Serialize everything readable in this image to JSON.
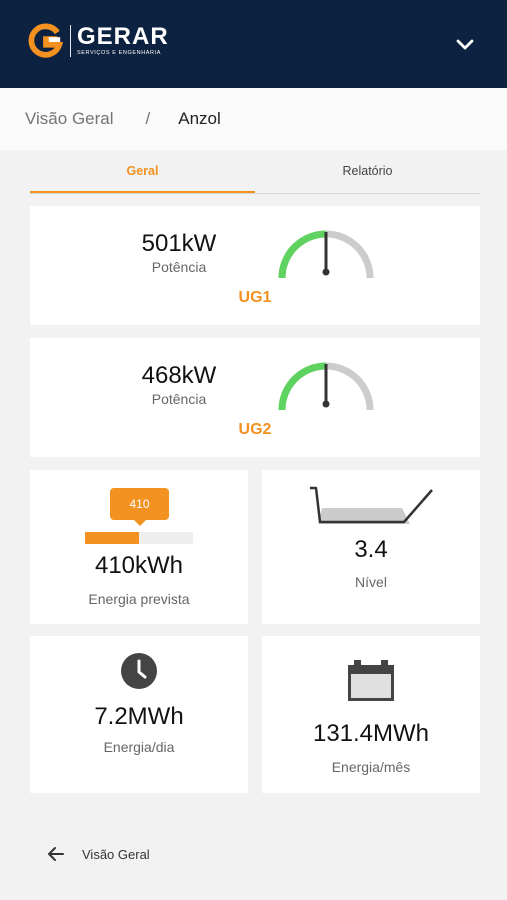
{
  "header": {
    "logo_name": "GERAR",
    "logo_sub": "SERVIÇOS E ENGENHARIA",
    "menu_icon": "chevron-down-icon",
    "colors": {
      "navy": "#0d2240",
      "orange": "#f39121"
    }
  },
  "breadcrumb": {
    "root": "Visão Geral",
    "separator": "/",
    "current": "Anzol"
  },
  "tabs": [
    {
      "label": "Geral",
      "active": true
    },
    {
      "label": "Relatório",
      "active": false
    }
  ],
  "units": [
    {
      "value": "501kW",
      "label": "Potência",
      "name": "UG1",
      "gauge_fraction": 0.5
    },
    {
      "value": "468kW",
      "label": "Potência",
      "name": "UG2",
      "gauge_fraction": 0.5
    }
  ],
  "energy_forecast": {
    "tooltip": "410",
    "progress_fraction": 0.5,
    "value": "410kWh",
    "label": "Energia prevista"
  },
  "level": {
    "value": "3.4",
    "label": "Nível",
    "icon": "reservoir-icon"
  },
  "energy_day": {
    "value": "7.2MWh",
    "label": "Energia/dia",
    "icon": "clock-icon"
  },
  "energy_month": {
    "value": "131.4MWh",
    "label": "Energia/mês",
    "icon": "battery-icon"
  },
  "footer": {
    "back_label": "Visão Geral",
    "back_icon": "arrow-left-icon"
  }
}
